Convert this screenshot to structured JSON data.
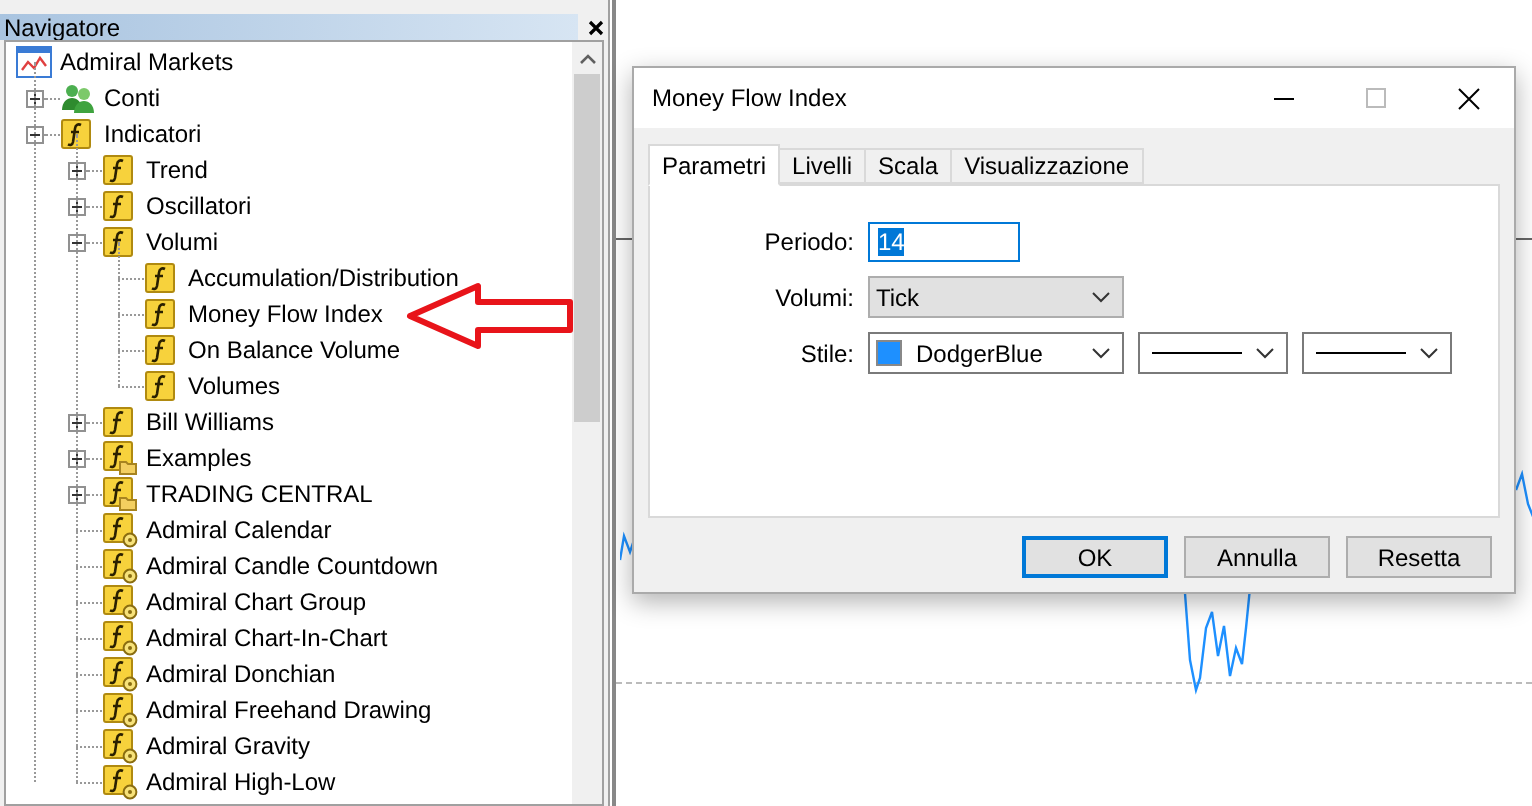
{
  "navigator": {
    "title": "Navigatore",
    "tree": [
      {
        "label": "Admiral Markets",
        "kind": "platform",
        "children": [
          {
            "label": "Conti",
            "kind": "accounts",
            "expanded": false
          },
          {
            "label": "Indicatori",
            "kind": "indicator",
            "expanded": true,
            "children": [
              {
                "label": "Trend",
                "kind": "indicator",
                "expanded": false
              },
              {
                "label": "Oscillatori",
                "kind": "indicator",
                "expanded": false
              },
              {
                "label": "Volumi",
                "kind": "indicator",
                "expanded": true,
                "children": [
                  {
                    "label": "Accumulation/Distribution",
                    "kind": "indicator"
                  },
                  {
                    "label": "Money Flow Index",
                    "kind": "indicator"
                  },
                  {
                    "label": "On Balance Volume",
                    "kind": "indicator"
                  },
                  {
                    "label": "Volumes",
                    "kind": "indicator"
                  }
                ]
              },
              {
                "label": "Bill Williams",
                "kind": "indicator",
                "expanded": false
              },
              {
                "label": "Examples",
                "kind": "folder",
                "expanded": false
              },
              {
                "label": "TRADING CENTRAL",
                "kind": "folder",
                "expanded": false
              },
              {
                "label": "Admiral Calendar",
                "kind": "custom"
              },
              {
                "label": "Admiral Candle Countdown",
                "kind": "custom"
              },
              {
                "label": "Admiral Chart Group",
                "kind": "custom"
              },
              {
                "label": "Admiral Chart-In-Chart",
                "kind": "custom"
              },
              {
                "label": "Admiral Donchian",
                "kind": "custom"
              },
              {
                "label": "Admiral Freehand Drawing",
                "kind": "custom"
              },
              {
                "label": "Admiral Gravity",
                "kind": "custom"
              },
              {
                "label": "Admiral High-Low",
                "kind": "custom"
              }
            ]
          }
        ]
      }
    ]
  },
  "dialog": {
    "title": "Money Flow Index",
    "tabs": [
      {
        "label": "Parametri",
        "selected": true
      },
      {
        "label": "Livelli",
        "selected": false
      },
      {
        "label": "Scala",
        "selected": false
      },
      {
        "label": "Visualizzazione",
        "selected": false
      }
    ],
    "fields": [
      {
        "label": "Periodo:",
        "kind": "input",
        "value": "14",
        "text_selected": true
      },
      {
        "label": "Volumi:",
        "kind": "select",
        "value": "Tick"
      },
      {
        "label": "Stile:",
        "kind": "style",
        "value": "DodgerBlue",
        "color": "#1e90ff"
      }
    ],
    "buttons": [
      {
        "label": "OK",
        "default": true
      },
      {
        "label": "Annulla",
        "default": false
      },
      {
        "label": "Resetta",
        "default": false
      }
    ]
  }
}
